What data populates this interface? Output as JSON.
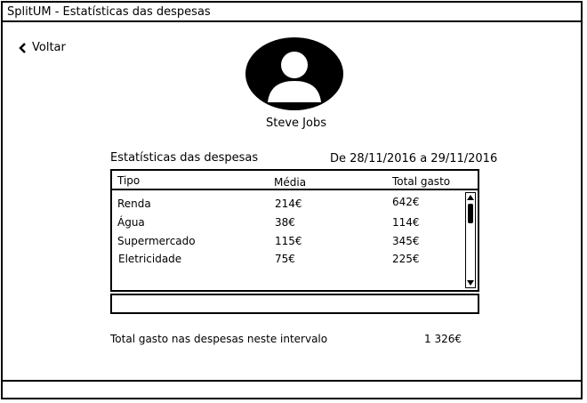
{
  "window": {
    "title": "SplitUM - Estatísticas das despesas"
  },
  "nav": {
    "back_label": "Voltar"
  },
  "user": {
    "name": "Steve Jobs",
    "avatar_icon": "user-avatar-icon"
  },
  "stats": {
    "title": "Estatísticas das despesas",
    "date_range": "De 28/11/2016 a 29/11/2016",
    "columns": [
      "Tipo",
      "Média",
      "Total gasto"
    ],
    "rows": [
      {
        "tipo": "Renda",
        "media": "214€",
        "total": "642€"
      },
      {
        "tipo": "Água",
        "media": "38€",
        "total": "114€"
      },
      {
        "tipo": "Supermercado",
        "media": "115€",
        "total": "345€"
      },
      {
        "tipo": "Eletricidade",
        "media": "75€",
        "total": "225€"
      }
    ],
    "total_label": "Total gasto nas despesas neste intervalo",
    "total_value": "1 326€"
  }
}
